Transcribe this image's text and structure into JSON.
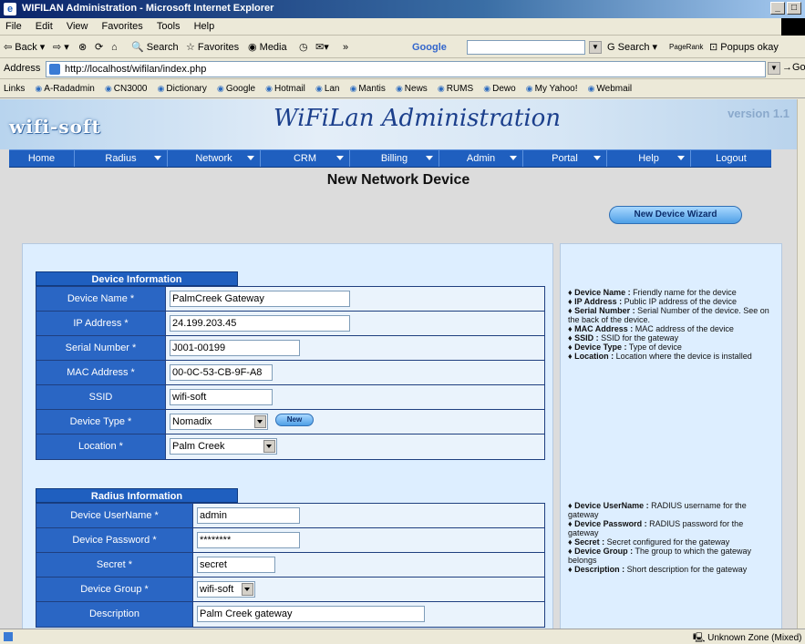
{
  "window": {
    "title": "WIFILAN Administration - Microsoft Internet Explorer"
  },
  "menubar": [
    "File",
    "Edit",
    "View",
    "Favorites",
    "Tools",
    "Help"
  ],
  "toolbar": {
    "back": "Back",
    "search": "Search",
    "favorites": "Favorites",
    "media": "Media",
    "google": "Google",
    "gsearch": "Search",
    "pagerank": "PageRank",
    "popups": "Popups okay"
  },
  "address": {
    "label": "Address",
    "url": "http://localhost/wifilan/index.php",
    "go": "Go"
  },
  "links": {
    "label": "Links",
    "items": [
      "A-Radadmin",
      "CN3000",
      "Dictionary",
      "Google",
      "Hotmail",
      "Lan",
      "Mantis",
      "News",
      "RUMS",
      "Dewo",
      "My Yahoo!",
      "Webmail"
    ]
  },
  "app": {
    "logo": "wifi-soft",
    "title": "WiFiLan Administration",
    "version": "version 1.1",
    "nav": [
      {
        "label": "Home",
        "dropdown": false
      },
      {
        "label": "Radius",
        "dropdown": true
      },
      {
        "label": "Network",
        "dropdown": true
      },
      {
        "label": "CRM",
        "dropdown": true
      },
      {
        "label": "Billing",
        "dropdown": true
      },
      {
        "label": "Admin",
        "dropdown": true
      },
      {
        "label": "Portal",
        "dropdown": true
      },
      {
        "label": "Help",
        "dropdown": true
      },
      {
        "label": "Logout",
        "dropdown": false
      }
    ],
    "page_title": "New Network Device",
    "wizard_button": "New Device Wizard"
  },
  "device_info": {
    "header": "Device Information",
    "fields": {
      "device_name": {
        "label": "Device Name *",
        "value": "PalmCreek Gateway"
      },
      "ip_address": {
        "label": "IP Address *",
        "value": "24.199.203.45"
      },
      "serial_number": {
        "label": "Serial Number *",
        "value": "J001-00199"
      },
      "mac_address": {
        "label": "MAC Address *",
        "value": "00-0C-53-CB-9F-A8"
      },
      "ssid": {
        "label": "SSID",
        "value": "wifi-soft"
      },
      "device_type": {
        "label": "Device Type *",
        "value": "Nomadix",
        "button": "New"
      },
      "location": {
        "label": "Location *",
        "value": "Palm Creek"
      }
    }
  },
  "radius_info": {
    "header": "Radius Information",
    "fields": {
      "device_username": {
        "label": "Device UserName *",
        "value": "admin"
      },
      "device_password": {
        "label": "Device Password *",
        "value": "********"
      },
      "secret": {
        "label": "Secret *",
        "value": "secret"
      },
      "device_group": {
        "label": "Device Group *",
        "value": "wifi-soft"
      },
      "description": {
        "label": "Description",
        "value": "Palm Creek gateway"
      }
    }
  },
  "help_device": [
    {
      "term": "Device Name :",
      "text": "Friendly name for the device"
    },
    {
      "term": "IP Address :",
      "text": "Public IP address of the device"
    },
    {
      "term": "Serial Number :",
      "text": "Serial Number of the device. See on the back of the device."
    },
    {
      "term": "MAC Address :",
      "text": "MAC address of the device"
    },
    {
      "term": "SSID :",
      "text": "SSID for the gateway"
    },
    {
      "term": "Device Type :",
      "text": "Type of device"
    },
    {
      "term": "Location :",
      "text": "Location where the device is installed"
    }
  ],
  "help_radius": [
    {
      "term": "Device UserName :",
      "text": "RADIUS username for the gateway"
    },
    {
      "term": "Device Password :",
      "text": "RADIUS password for the gateway"
    },
    {
      "term": "Secret :",
      "text": "Secret configured for the gateway"
    },
    {
      "term": "Device Group :",
      "text": "The group to which the gateway belongs"
    },
    {
      "term": "Description :",
      "text": "Short description for the gateway"
    }
  ],
  "statusbar": {
    "zone": "Unknown Zone (Mixed)"
  },
  "colors": {
    "nav": "#1f5fbf",
    "label_cell": "#2a66c4",
    "panel": "#ddeeff"
  }
}
